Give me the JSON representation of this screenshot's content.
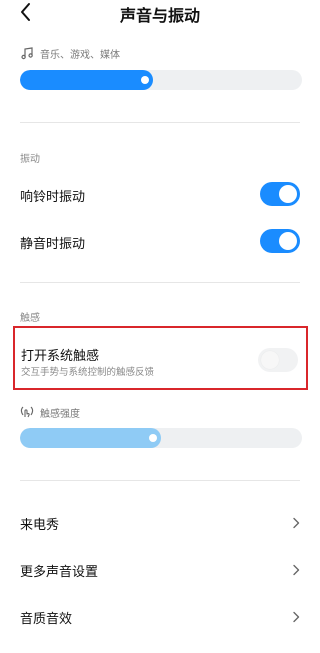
{
  "header": {
    "title": "声音与振动"
  },
  "media_volume": {
    "label": "音乐、游戏、媒体",
    "level": 0.47,
    "color": "#1a8cff"
  },
  "vibration": {
    "section_label": "振动",
    "items": [
      {
        "label": "响铃时振动",
        "on": true
      },
      {
        "label": "静音时振动",
        "on": true
      }
    ]
  },
  "haptics": {
    "section_label": "触感",
    "system_haptics": {
      "label": "打开系统触感",
      "sublabel": "交互手势与系统控制的触感反馈",
      "on": false
    },
    "strength": {
      "label": "触感强度",
      "level": 0.5,
      "color": "#8fcbf5"
    }
  },
  "links": [
    {
      "label": "来电秀"
    },
    {
      "label": "更多声音设置"
    },
    {
      "label": "音质音效"
    }
  ],
  "colors": {
    "accent": "#1a8cff",
    "highlight_border": "#d9262b"
  }
}
